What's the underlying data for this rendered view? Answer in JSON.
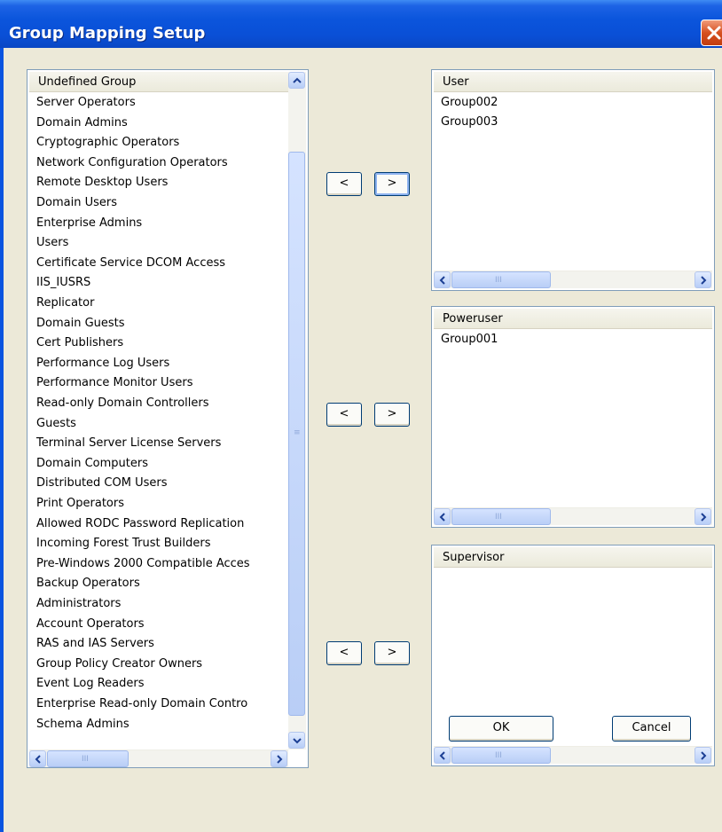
{
  "window": {
    "title": "Group Mapping Setup"
  },
  "undefined_list": {
    "header": "Undefined Group",
    "items": [
      "Server Operators",
      "Domain Admins",
      "Cryptographic Operators",
      "Network Configuration Operators",
      "Remote Desktop Users",
      "Domain Users",
      "Enterprise Admins",
      "Users",
      "Certificate Service DCOM Access",
      "IIS_IUSRS",
      "Replicator",
      "Domain Guests",
      "Cert Publishers",
      "Performance Log Users",
      "Performance Monitor Users",
      "Read-only Domain Controllers",
      "Guests",
      "Terminal Server License Servers",
      "Domain Computers",
      "Distributed COM Users",
      "Print Operators",
      "Allowed RODC Password Replication",
      "Incoming Forest Trust Builders",
      "Pre-Windows 2000 Compatible Acces",
      "Backup Operators",
      "Administrators",
      "Account Operators",
      "RAS and IAS Servers",
      "Group Policy Creator Owners",
      "Event Log Readers",
      "Enterprise Read-only Domain Contro",
      "Schema Admins"
    ]
  },
  "role_lists": [
    {
      "header": "User",
      "items": [
        "Group002",
        "Group003"
      ]
    },
    {
      "header": "Poweruser",
      "items": [
        "Group001"
      ]
    },
    {
      "header": "Supervisor",
      "items": []
    }
  ],
  "move_buttons": {
    "left_label": "<",
    "right_label": ">"
  },
  "scrollbar": {
    "grip": "III",
    "vgrip": "≡"
  },
  "buttons": {
    "ok": "OK",
    "cancel": "Cancel"
  },
  "colors": {
    "titlebar": "#0a54e0",
    "dialog_bg": "#ece9d8",
    "close": "#d6501f"
  }
}
